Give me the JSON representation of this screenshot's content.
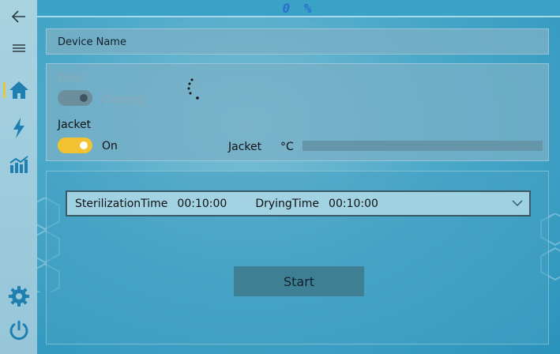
{
  "topbar": {
    "percent_text": "0 %"
  },
  "sidebar": {
    "items": [
      {
        "name": "back",
        "icon": "arrow-left-icon"
      },
      {
        "name": "menu",
        "icon": "hamburger-icon"
      },
      {
        "name": "home",
        "icon": "home-icon",
        "active": true
      },
      {
        "name": "power",
        "icon": "lightning-icon"
      },
      {
        "name": "charts",
        "icon": "bar-chart-icon"
      },
      {
        "name": "settings",
        "icon": "gear-icon"
      },
      {
        "name": "shutdown",
        "icon": "power-icon"
      }
    ],
    "icon_color": "#1f7fb0",
    "active_marker_color": "#e8c53a"
  },
  "device": {
    "name_label": "Device Name"
  },
  "door": {
    "label": "Door",
    "state_label": "Closing",
    "toggle_on": false
  },
  "jacket": {
    "label": "Jacket",
    "state_label": "On",
    "toggle_on": true,
    "temp_label": "Jacket",
    "unit": "°C",
    "progress": 0
  },
  "program": {
    "sterilization_label": "SterilizationTime",
    "sterilization_value": "00:10:00",
    "drying_label": "DryingTime",
    "drying_value": "00:10:00"
  },
  "actions": {
    "start_label": "Start"
  },
  "colors": {
    "accent_yellow": "#f2c230",
    "percent_blue": "#2a6fd0"
  }
}
